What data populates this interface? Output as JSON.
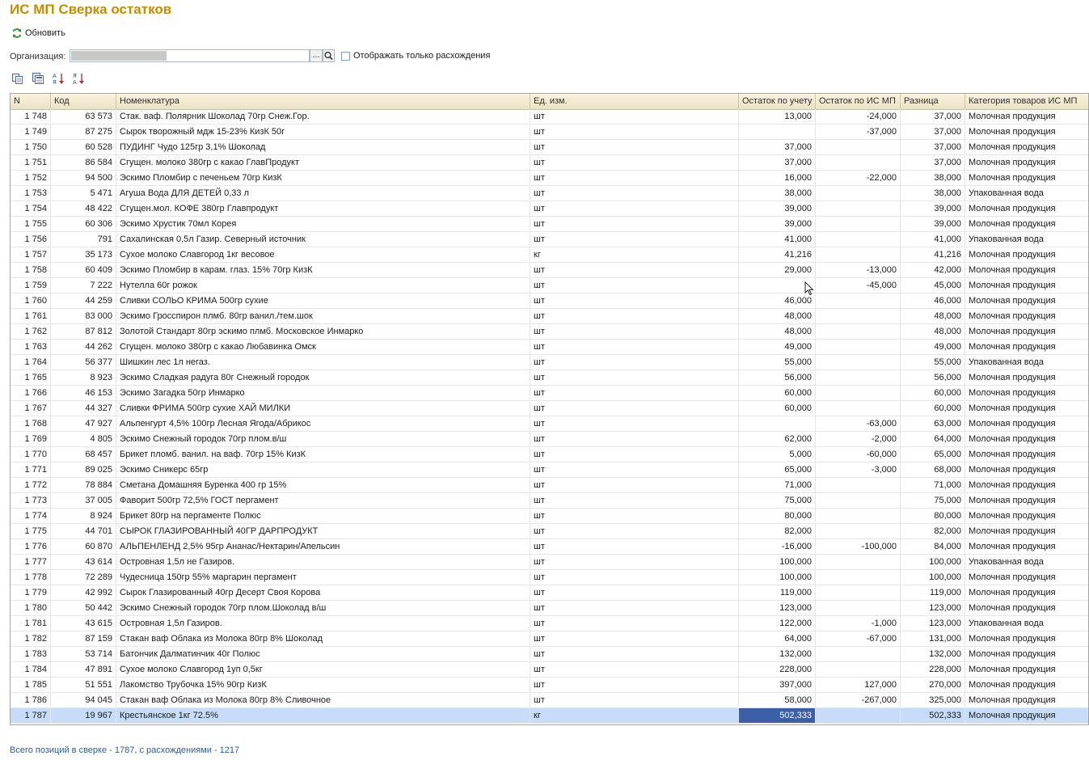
{
  "window": {
    "title": "ИС МП Сверка остатков"
  },
  "toolbar": {
    "refresh_label": "Обновить"
  },
  "filter": {
    "org_label": "Организация:",
    "org_select_label": "...",
    "only_diff_label": "Отображать только расхождения",
    "only_diff_checked": false
  },
  "table": {
    "columns": [
      "N",
      "Код",
      "Номенклатура",
      "Ед. изм.",
      "Остаток по учету",
      "Остаток по ИС МП",
      "Разница",
      "Категория товаров ИС МП"
    ],
    "rows": [
      [
        "1 748",
        "63 573",
        "Стак. ваф. Полярник Шоколад 70гр Снеж.Гор.",
        "шт",
        "13,000",
        "-24,000",
        "37,000",
        "Молочная продукция"
      ],
      [
        "1 749",
        "87 275",
        "Сырок творожный мдж 15-23% КизК 50г",
        "шт",
        "",
        "-37,000",
        "37,000",
        "Молочная продукция"
      ],
      [
        "1 750",
        "60 528",
        "ПУДИНГ Чудо 125гр 3,1% Шоколад",
        "шт",
        "37,000",
        "",
        "37,000",
        "Молочная продукция"
      ],
      [
        "1 751",
        "86 584",
        "Сгущен. молоко 380гр с какао ГлавПродукт",
        "шт",
        "37,000",
        "",
        "37,000",
        "Молочная продукция"
      ],
      [
        "1 752",
        "94 500",
        "Эскимо Пломбир с печеньем 70гр КизК",
        "шт",
        "16,000",
        "-22,000",
        "38,000",
        "Молочная продукция"
      ],
      [
        "1 753",
        "5 471",
        "Агуша Вода ДЛЯ ДЕТЕЙ 0,33 л",
        "шт",
        "38,000",
        "",
        "38,000",
        "Упакованная вода"
      ],
      [
        "1 754",
        "48 422",
        "Сгущен.мол. КОФЕ 380гр Главпродукт",
        "шт",
        "39,000",
        "",
        "39,000",
        "Молочная продукция"
      ],
      [
        "1 755",
        "60 306",
        "Эскимо Хрустик 70мл Корея",
        "шт",
        "39,000",
        "",
        "39,000",
        "Молочная продукция"
      ],
      [
        "1 756",
        "791",
        "Сахалинская 0,5л Газир. Северный источник",
        "шт",
        "41,000",
        "",
        "41,000",
        "Упакованная вода"
      ],
      [
        "1 757",
        "35 173",
        "Сухое молоко Славгород 1кг весовое",
        "кг",
        "41,216",
        "",
        "41,216",
        "Молочная продукция"
      ],
      [
        "1 758",
        "60 409",
        "Эскимо Пломбир в карам. глаз. 15% 70гр КизК",
        "шт",
        "29,000",
        "-13,000",
        "42,000",
        "Молочная продукция"
      ],
      [
        "1 759",
        "7 222",
        "Нутелла 60г рожок",
        "шт",
        "",
        "-45,000",
        "45,000",
        "Молочная продукция"
      ],
      [
        "1 760",
        "44 259",
        "Сливки СОЛЬО КРИМА 500гр сухие",
        "шт",
        "46,000",
        "",
        "46,000",
        "Молочная продукция"
      ],
      [
        "1 761",
        "83 000",
        "Эскимо Гросспирон плмб. 80гр ванил./тем.шок",
        "шт",
        "48,000",
        "",
        "48,000",
        "Молочная продукция"
      ],
      [
        "1 762",
        "87 812",
        "Золотой Стандарт 80гр эскимо плмб. Московское Инмарко",
        "шт",
        "48,000",
        "",
        "48,000",
        "Молочная продукция"
      ],
      [
        "1 763",
        "44 262",
        "Сгущен. молоко 380гр с какао Любавинка Омск",
        "шт",
        "49,000",
        "",
        "49,000",
        "Молочная продукция"
      ],
      [
        "1 764",
        "56 377",
        "Шишкин лес 1л негаз.",
        "шт",
        "55,000",
        "",
        "55,000",
        "Упакованная вода"
      ],
      [
        "1 765",
        "8 923",
        "Эскимо Сладкая радуга 80г Снежный городок",
        "шт",
        "56,000",
        "",
        "56,000",
        "Молочная продукция"
      ],
      [
        "1 766",
        "46 153",
        "Эскимо Загадка 50гр Инмарко",
        "шт",
        "60,000",
        "",
        "60,000",
        "Молочная продукция"
      ],
      [
        "1 767",
        "44 327",
        "Сливки ФРИМА 500гр сухие ХАЙ МИЛКИ",
        "шт",
        "60,000",
        "",
        "60,000",
        "Молочная продукция"
      ],
      [
        "1 768",
        "47 927",
        "Альпенгурт 4,5% 100гр Лесная Ягода/Абрикос",
        "шт",
        "",
        "-63,000",
        "63,000",
        "Молочная продукция"
      ],
      [
        "1 769",
        "4 805",
        "Эскимо Снежный городок 70гр плом.в/ш",
        "шт",
        "62,000",
        "-2,000",
        "64,000",
        "Молочная продукция"
      ],
      [
        "1 770",
        "68 457",
        "Брикет пломб. ванил. на ваф. 70гр 15% КизК",
        "шт",
        "5,000",
        "-60,000",
        "65,000",
        "Молочная продукция"
      ],
      [
        "1 771",
        "89 025",
        "Эскимо Сникерс 65гр",
        "шт",
        "65,000",
        "-3,000",
        "68,000",
        "Молочная продукция"
      ],
      [
        "1 772",
        "78 884",
        "Сметана Домашняя Буренка 400 гр 15%",
        "шт",
        "71,000",
        "",
        "71,000",
        "Молочная продукция"
      ],
      [
        "1 773",
        "37 005",
        "Фаворит 500гр 72,5% ГОСТ пергамент",
        "шт",
        "75,000",
        "",
        "75,000",
        "Молочная продукция"
      ],
      [
        "1 774",
        "8 924",
        "Брикет 80гр на пергаменте Полюс",
        "шт",
        "80,000",
        "",
        "80,000",
        "Молочная продукция"
      ],
      [
        "1 775",
        "44 701",
        "СЫРОК ГЛАЗИРОВАННЫЙ 40ГР ДАРПРОДУКТ",
        "шт",
        "82,000",
        "",
        "82,000",
        "Молочная продукция"
      ],
      [
        "1 776",
        "60 870",
        "АЛЬПЕНЛЕНД 2,5% 95гр Ананас/Нектарин/Апельсин",
        "шт",
        "-16,000",
        "-100,000",
        "84,000",
        "Молочная продукция"
      ],
      [
        "1 777",
        "43 614",
        "Островная 1,5л не Газиров.",
        "шт",
        "100,000",
        "",
        "100,000",
        "Упакованная вода"
      ],
      [
        "1 778",
        "72 289",
        "Чудесница 150гр 55% маргарин пергамент",
        "шт",
        "100,000",
        "",
        "100,000",
        "Молочная продукция"
      ],
      [
        "1 779",
        "42 992",
        "Сырок Глазированный 40гр Десерт Своя Корова",
        "шт",
        "119,000",
        "",
        "119,000",
        "Молочная продукция"
      ],
      [
        "1 780",
        "50 442",
        "Эскимо Снежный городок 70гр плом.Шоколад в/ш",
        "шт",
        "123,000",
        "",
        "123,000",
        "Молочная продукция"
      ],
      [
        "1 781",
        "43 615",
        "Островная 1,5л Газиров.",
        "шт",
        "122,000",
        "-1,000",
        "123,000",
        "Упакованная вода"
      ],
      [
        "1 782",
        "87 159",
        "Стакан ваф Облака из Молока 80гр 8% Шоколад",
        "шт",
        "64,000",
        "-67,000",
        "131,000",
        "Молочная продукция"
      ],
      [
        "1 783",
        "53 714",
        "Батончик Далматинчик 40г Полюс",
        "шт",
        "132,000",
        "",
        "132,000",
        "Молочная продукция"
      ],
      [
        "1 784",
        "47 891",
        "Сухое молоко Славгород 1уп 0,5кг",
        "шт",
        "228,000",
        "",
        "228,000",
        "Молочная продукция"
      ],
      [
        "1 785",
        "51 551",
        "Лакомство Трубочка 15% 90гр КизК",
        "шт",
        "397,000",
        "127,000",
        "270,000",
        "Молочная продукция"
      ],
      [
        "1 786",
        "94 045",
        "Стакан ваф Облака из Молока 80гр 8% Сливочное",
        "шт",
        "58,000",
        "-267,000",
        "325,000",
        "Молочная продукция"
      ],
      [
        "1 787",
        "19 967",
        "Крестьянское 1кг 72.5%",
        "кг",
        "502,333",
        "",
        "502,333",
        "Молочная продукция"
      ]
    ],
    "selected_row_index": 39
  },
  "status": {
    "text": "Всего позиций в сверке - 1787, с расхождениями - 1217"
  },
  "colors": {
    "title": "#c58c00",
    "header_bg": "#efe6c9",
    "selected_row": "#c7dcf6",
    "selected_cell": "#3d5fa8",
    "status_text": "#2d5c9c"
  }
}
